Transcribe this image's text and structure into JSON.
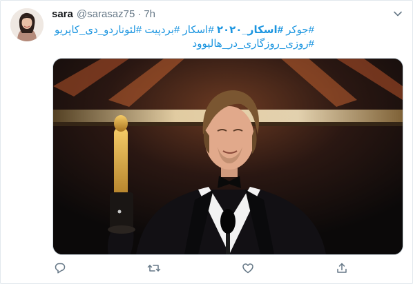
{
  "tweet": {
    "author_name": "sara",
    "author_handle": "@sarasaz75",
    "separator": "·",
    "time": "7h",
    "text_lines": [
      "#جوکر #اسکار_۲۰۲۰ #اسکار #بردپیت #لئوناردو_دی_کاپریو",
      "#روزی_روزگاری_در_هالیوود"
    ],
    "text_line1_plain_a": "#جوکر ",
    "text_line1_bold": "#اسکار_۲۰۲۰",
    "text_line1_plain_b": " #اسکار #بردپیت #لئوناردو_دی_کاپریو",
    "link_color": "#1b95e0"
  },
  "icons": {
    "menu": "chevron-down-icon",
    "reply": "reply-icon",
    "retweet": "retweet-icon",
    "like": "heart-icon",
    "share": "share-icon"
  },
  "colors": {
    "secondary_text": "#657786",
    "border": "#e1e8ed"
  }
}
